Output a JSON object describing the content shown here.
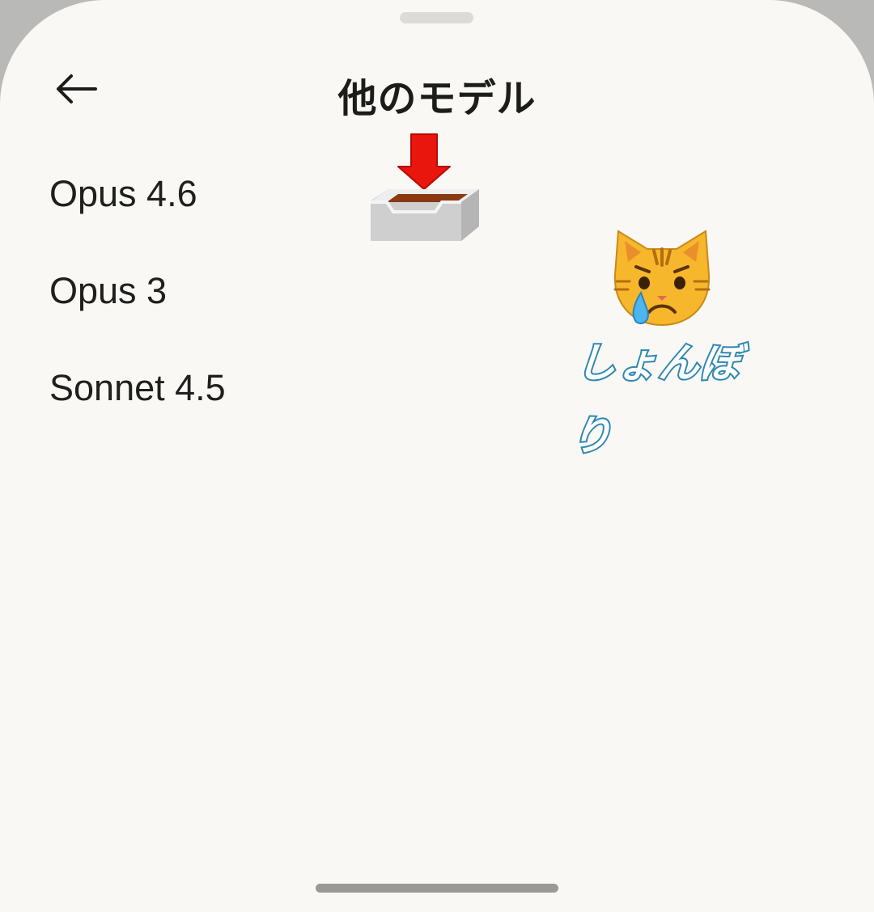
{
  "header": {
    "title": "他のモデル",
    "back_icon": "arrow-left-icon"
  },
  "models": [
    {
      "label": "Opus 4.6"
    },
    {
      "label": "Opus 3"
    },
    {
      "label": "Sonnet 4.5"
    }
  ],
  "stickers": {
    "inbox": "inbox-tray-download-icon",
    "cat": "crying-cat-face-icon",
    "caption": "しょんぼり"
  },
  "colors": {
    "background": "#f9f8f5",
    "text": "#1f1f1d",
    "arrow_red": "#e8160c",
    "caption_outline": "#2d87b0"
  }
}
